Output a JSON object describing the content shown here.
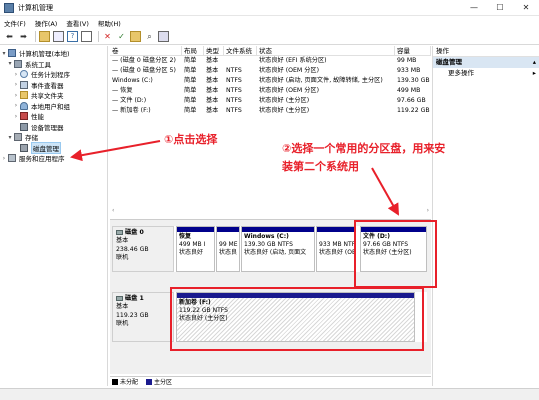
{
  "window": {
    "title": "计算机管理",
    "minimize": "—",
    "maximize": "☐",
    "close": "✕"
  },
  "menu": [
    "文件(F)",
    "操作(A)",
    "查看(V)",
    "帮助(H)"
  ],
  "tree": {
    "root": "计算机管理(本地)",
    "items": [
      {
        "label": "系统工具",
        "level": 1,
        "arrow": "▾"
      },
      {
        "label": "任务计划程序",
        "level": 2,
        "arrow": "›"
      },
      {
        "label": "事件查看器",
        "level": 2,
        "arrow": "›"
      },
      {
        "label": "共享文件夹",
        "level": 2,
        "arrow": "›"
      },
      {
        "label": "本地用户和组",
        "level": 2,
        "arrow": "›"
      },
      {
        "label": "性能",
        "level": 2,
        "arrow": "›"
      },
      {
        "label": "设备管理器",
        "level": 2,
        "arrow": ""
      },
      {
        "label": "存储",
        "level": 1,
        "arrow": "▾"
      },
      {
        "label": "磁盘管理",
        "level": 2,
        "arrow": "",
        "selected": true
      },
      {
        "label": "服务和应用程序",
        "level": 1,
        "arrow": "›"
      }
    ]
  },
  "volumes": {
    "headers": [
      "卷",
      "布局",
      "类型",
      "文件系统",
      "状态",
      "容量"
    ],
    "rows": [
      [
        "— (磁盘 0 磁盘分区 2)",
        "简单",
        "基本",
        "",
        "状态良好 (EFI 系统分区)",
        "99 MB"
      ],
      [
        "— (磁盘 0 磁盘分区 5)",
        "简单",
        "基本",
        "NTFS",
        "状态良好 (OEM 分区)",
        "933 MB"
      ],
      [
        "Windows (C:)",
        "简单",
        "基本",
        "NTFS",
        "状态良好 (启动, 页面文件, 故障转储, 主分区)",
        "139.30 GB"
      ],
      [
        "— 恢复",
        "简单",
        "基本",
        "NTFS",
        "状态良好 (OEM 分区)",
        "499 MB"
      ],
      [
        "— 文件 (D:)",
        "简单",
        "基本",
        "NTFS",
        "状态良好 (主分区)",
        "97.66 GB"
      ],
      [
        "— 新加卷 (F:)",
        "简单",
        "基本",
        "NTFS",
        "状态良好 (主分区)",
        "119.22 GB"
      ]
    ]
  },
  "disk0": {
    "name": "磁盘 0",
    "type": "基本",
    "size": "238.46 GB",
    "state": "联机",
    "partitions": [
      {
        "name": "恢复",
        "size": "499 MB I",
        "status": "状态良好"
      },
      {
        "name": "",
        "size": "99 ME",
        "status": "状态良"
      },
      {
        "name": "Windows (C:)",
        "size": "139.30 GB NTFS",
        "status": "状态良好 (启动, 页面文"
      },
      {
        "name": "",
        "size": "933 MB NTFS",
        "status": "状态良好 (OEM"
      },
      {
        "name": "文件 (D:)",
        "size": "97.66 GB NTFS",
        "status": "状态良好 (主分区)"
      }
    ]
  },
  "disk1": {
    "name": "磁盘 1",
    "type": "基本",
    "size": "119.23 GB",
    "state": "联机",
    "partition": {
      "name": "新加卷 (F:)",
      "size": "119.22 GB NTFS",
      "status": "状态良好 (主分区)"
    }
  },
  "legend": [
    {
      "label": "未分配",
      "color": "#000000"
    },
    {
      "label": "主分区",
      "color": "#1a1a8e"
    }
  ],
  "actions": {
    "header": "操作",
    "section": "磁盘管理",
    "section_arrow": "▴",
    "item": "更多操作",
    "item_arrow": "▸"
  },
  "annotations": {
    "step1": "①点击选择",
    "step2_line1": "②选择一个常用的分区盘，用来安",
    "step2_line2": "装第二个系统用"
  },
  "colors": {
    "annotation": "#e8202a",
    "partition_bar": "#00008b",
    "selection": "#cce4f7"
  }
}
